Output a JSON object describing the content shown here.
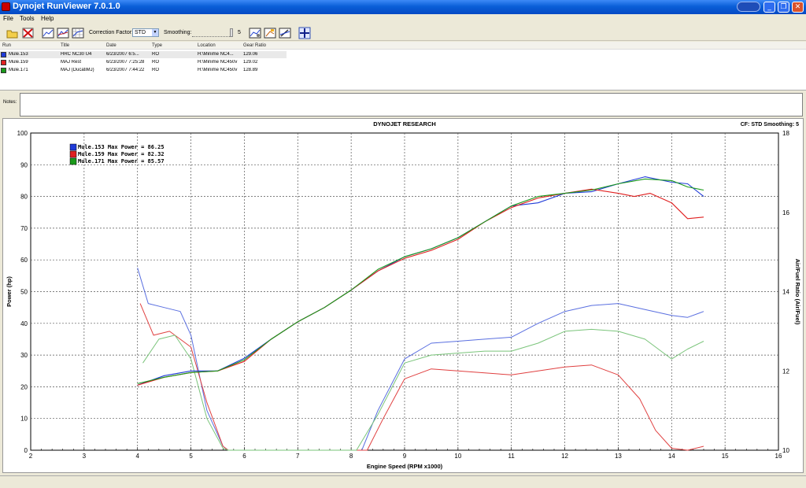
{
  "window": {
    "title": "Dynojet RunViewer 7.0.1.0",
    "minimize_icon": "minimize-icon",
    "restore_icon": "restore-icon",
    "close_icon": "close-icon"
  },
  "menu": [
    "File",
    "Tools",
    "Help"
  ],
  "toolbar": {
    "correction_factor_label": "Correction Factor:",
    "correction_factor_value": "STD",
    "smoothing_label": "Smoothing:",
    "smoothing_value": "5",
    "icons": [
      "open-folder-icon",
      "delete-icon",
      "graph-icon",
      "graph-overlay-icon",
      "graph-grid-icon",
      "graph-settings-icon",
      "graph-paint-icon",
      "graph-edit-icon",
      "crosshair-icon"
    ]
  },
  "runs": {
    "headers": [
      "Run",
      "Title",
      "Date",
      "Type",
      "Location",
      "Gear Ratio"
    ],
    "rows": [
      {
        "run": "Mule.153",
        "title": "HRC NC30 U4",
        "date": "6/23/2007 6:5...",
        "type": "RO",
        "location": "H:\\Minime NC4...",
        "gear": "129.06",
        "color": "#1f3bd8"
      },
      {
        "run": "Mule.159",
        "title": "MAJ Rest",
        "date": "6/23/2007 7:25:28",
        "type": "RO",
        "location": "H:\\Minime NC450v",
        "gear": "129.02",
        "color": "#e02020"
      },
      {
        "run": "Mule.171",
        "title": "MAJ (DucatiMJ)",
        "date": "6/23/2007 7:44:22",
        "type": "RO",
        "location": "H:\\Minime NC450v",
        "gear": "128.89",
        "color": "#1a9a1a"
      }
    ]
  },
  "notes": {
    "label": "Notes:",
    "value": ""
  },
  "chart_data": {
    "type": "line",
    "title": "DYNOJET RESEARCH",
    "header_right": "CF: STD  Smoothing: 5",
    "xlabel": "Engine Speed (RPM x1000)",
    "ylabel": "Power (hp)",
    "y2label": "Air/Fuel Ratio (Air/Fuel)",
    "xlim": [
      2,
      16
    ],
    "ylim": [
      0,
      100
    ],
    "y2lim": [
      10,
      18
    ],
    "xticks": [
      "2",
      "3",
      "4",
      "5",
      "6",
      "7",
      "8",
      "9",
      "10",
      "11",
      "12",
      "13",
      "14",
      "15",
      "16"
    ],
    "yticks": [
      "0",
      "10",
      "20",
      "30",
      "40",
      "50",
      "60",
      "70",
      "80",
      "90",
      "100"
    ],
    "y2ticks": [
      "10",
      "12",
      "14",
      "16",
      "18"
    ],
    "grid": true,
    "legend_position": "top-left",
    "legend": [
      {
        "text": "Mule.153 Max Power = 86.25",
        "color": "#1f3bd8"
      },
      {
        "text": "Mule.159 Max Power = 82.32",
        "color": "#e02020"
      },
      {
        "text": "Mule.171 Max Power = 85.57",
        "color": "#1a9a1a"
      }
    ],
    "power_series": [
      {
        "name": "Mule.153",
        "color": "#1f3bd8",
        "x": [
          4.0,
          4.5,
          5.0,
          5.5,
          6.0,
          6.5,
          7.0,
          7.5,
          8.0,
          8.5,
          9.0,
          9.5,
          10.0,
          10.5,
          11.0,
          11.5,
          12.0,
          12.5,
          13.0,
          13.5,
          14.0,
          14.3,
          14.6
        ],
        "y": [
          20.5,
          23.5,
          25,
          25,
          29,
          35,
          40.5,
          45,
          50.5,
          56.5,
          61,
          63.5,
          67,
          72,
          77,
          78,
          81,
          81.5,
          84,
          86.2,
          84.5,
          84,
          80
        ]
      },
      {
        "name": "Mule.159",
        "color": "#e02020",
        "x": [
          4.0,
          4.5,
          5.0,
          5.5,
          6.0,
          6.5,
          7.0,
          7.5,
          8.0,
          8.5,
          9.0,
          9.5,
          10.0,
          10.5,
          11.0,
          11.5,
          12.0,
          12.5,
          13.0,
          13.3,
          13.6,
          14.0,
          14.3,
          14.6
        ],
        "y": [
          20.5,
          23,
          24.5,
          25,
          28,
          35,
          40.5,
          45,
          50.5,
          56.5,
          60.5,
          63,
          66.5,
          72,
          76.5,
          79.5,
          81,
          82.3,
          81,
          80,
          81,
          78,
          73,
          73.5
        ]
      },
      {
        "name": "Mule.171",
        "color": "#1a9a1a",
        "x": [
          4.0,
          4.5,
          5.0,
          5.5,
          6.0,
          6.5,
          7.0,
          7.5,
          8.0,
          8.5,
          9.0,
          9.5,
          10.0,
          10.5,
          11.0,
          11.5,
          12.0,
          12.5,
          13.0,
          13.5,
          14.0,
          14.3,
          14.6
        ],
        "y": [
          21,
          23,
          24.5,
          25,
          28.5,
          35,
          40.5,
          45,
          50.5,
          57,
          61,
          63.5,
          67,
          72,
          77,
          80,
          81,
          82,
          84,
          85.5,
          85,
          83,
          82
        ]
      }
    ],
    "afr_series": [
      {
        "name": "Mule.153",
        "color": "#5a6fe0",
        "x": [
          4.0,
          4.2,
          4.5,
          4.8,
          5.0,
          5.3,
          5.6,
          5.7,
          8.2,
          8.5,
          9.0,
          9.5,
          10.0,
          10.5,
          11.0,
          11.5,
          12.0,
          12.5,
          13.0,
          13.5,
          14.0,
          14.3,
          14.6
        ],
        "y": [
          14.6,
          13.7,
          13.6,
          13.5,
          12.9,
          11.0,
          10.1,
          10.0,
          10.0,
          11.0,
          12.3,
          12.7,
          12.75,
          12.8,
          12.85,
          13.2,
          13.5,
          13.65,
          13.7,
          13.55,
          13.4,
          13.35,
          13.5
        ]
      },
      {
        "name": "Mule.159",
        "color": "#e04040",
        "x": [
          4.05,
          4.3,
          4.6,
          5.0,
          5.3,
          5.6,
          5.7,
          8.3,
          8.6,
          9.0,
          9.5,
          10.0,
          10.5,
          11.0,
          11.5,
          12.0,
          12.5,
          13.0,
          13.4,
          13.7,
          14.0,
          14.3,
          14.6
        ],
        "y": [
          13.7,
          12.9,
          13.0,
          12.6,
          11.2,
          10.1,
          10.0,
          10.0,
          10.8,
          11.8,
          12.05,
          12.0,
          11.95,
          11.9,
          12.0,
          12.1,
          12.15,
          11.9,
          11.3,
          10.5,
          10.05,
          10.0,
          10.1
        ]
      },
      {
        "name": "Mule.171",
        "color": "#7ac47a",
        "x": [
          4.1,
          4.4,
          4.7,
          5.0,
          5.3,
          5.6,
          5.7,
          8.1,
          8.5,
          9.0,
          9.5,
          10.0,
          10.5,
          11.0,
          11.5,
          12.0,
          12.5,
          13.0,
          13.5,
          14.0,
          14.3,
          14.6
        ],
        "y": [
          12.2,
          12.8,
          12.9,
          12.3,
          10.8,
          10.05,
          10.0,
          10.0,
          10.9,
          12.2,
          12.4,
          12.45,
          12.5,
          12.5,
          12.7,
          13.0,
          13.05,
          13.0,
          12.8,
          12.3,
          12.55,
          12.75
        ]
      }
    ]
  }
}
